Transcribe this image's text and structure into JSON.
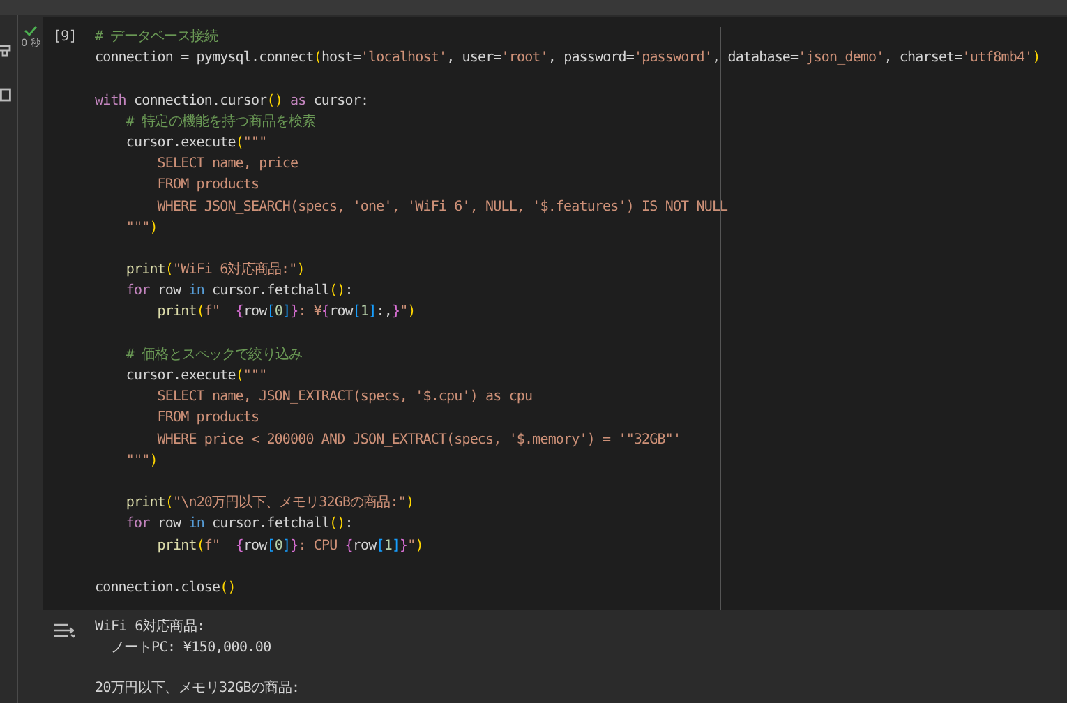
{
  "cell": {
    "execution_count": "[9]",
    "run_time": "0 秒",
    "run_ok": true,
    "code_lines": [
      {
        "kind": "code",
        "tokens": [
          {
            "kind": "comment",
            "text": "# データベース接続"
          }
        ]
      },
      {
        "kind": "code",
        "tokens": [
          {
            "kind": "plain",
            "text": "connection = pymysql.connect"
          },
          {
            "kind": "paren",
            "text": "("
          },
          {
            "kind": "plain",
            "text": "host="
          },
          {
            "kind": "string",
            "text": "'localhost'"
          },
          {
            "kind": "plain",
            "text": ", user="
          },
          {
            "kind": "string",
            "text": "'root'"
          },
          {
            "kind": "plain",
            "text": ", password="
          },
          {
            "kind": "string",
            "text": "'password'"
          },
          {
            "kind": "plain",
            "text": ", database="
          },
          {
            "kind": "string",
            "text": "'json_demo'"
          },
          {
            "kind": "plain",
            "text": ", charset="
          },
          {
            "kind": "string",
            "text": "'utf8mb4'"
          },
          {
            "kind": "paren",
            "text": ")"
          }
        ]
      },
      {
        "kind": "blank"
      },
      {
        "kind": "code",
        "tokens": [
          {
            "kind": "keyword",
            "text": "with"
          },
          {
            "kind": "plain",
            "text": " connection.cursor"
          },
          {
            "kind": "paren",
            "text": "()"
          },
          {
            "kind": "keyword",
            "text": " as"
          },
          {
            "kind": "plain",
            "text": " cursor:"
          }
        ]
      },
      {
        "kind": "code",
        "tokens": [
          {
            "kind": "comment",
            "text": "    # 特定の機能を持つ商品を検索"
          }
        ]
      },
      {
        "kind": "code",
        "tokens": [
          {
            "kind": "plain",
            "text": "    cursor.execute"
          },
          {
            "kind": "paren",
            "text": "("
          },
          {
            "kind": "string",
            "text": "\"\"\""
          }
        ]
      },
      {
        "kind": "code",
        "tokens": [
          {
            "kind": "string",
            "text": "        SELECT name, price"
          }
        ]
      },
      {
        "kind": "code",
        "tokens": [
          {
            "kind": "string",
            "text": "        FROM products"
          }
        ]
      },
      {
        "kind": "code",
        "tokens": [
          {
            "kind": "string",
            "text": "        WHERE JSON_SEARCH(specs, 'one', 'WiFi 6', NULL, '$.features') IS NOT NULL"
          }
        ]
      },
      {
        "kind": "code",
        "tokens": [
          {
            "kind": "string",
            "text": "    \"\"\""
          },
          {
            "kind": "paren",
            "text": ")"
          }
        ]
      },
      {
        "kind": "blank"
      },
      {
        "kind": "code",
        "tokens": [
          {
            "kind": "func",
            "text": "    print"
          },
          {
            "kind": "paren",
            "text": "("
          },
          {
            "kind": "string",
            "text": "\"WiFi 6対応商品:\""
          },
          {
            "kind": "paren",
            "text": ")"
          }
        ]
      },
      {
        "kind": "code",
        "tokens": [
          {
            "kind": "keyword",
            "text": "    for"
          },
          {
            "kind": "plain",
            "text": " row "
          },
          {
            "kind": "operator",
            "text": "in"
          },
          {
            "kind": "plain",
            "text": " cursor.fetchall"
          },
          {
            "kind": "paren",
            "text": "()"
          },
          {
            "kind": "plain",
            "text": ":"
          }
        ]
      },
      {
        "kind": "code",
        "tokens": [
          {
            "kind": "func",
            "text": "        print"
          },
          {
            "kind": "paren",
            "text": "("
          },
          {
            "kind": "string",
            "text": "f\"  "
          },
          {
            "kind": "brace",
            "text": "{"
          },
          {
            "kind": "plain",
            "text": "row"
          },
          {
            "kind": "bracket",
            "text": "["
          },
          {
            "kind": "number",
            "text": "0"
          },
          {
            "kind": "bracket",
            "text": "]"
          },
          {
            "kind": "brace",
            "text": "}"
          },
          {
            "kind": "string",
            "text": ": ¥"
          },
          {
            "kind": "brace",
            "text": "{"
          },
          {
            "kind": "plain",
            "text": "row"
          },
          {
            "kind": "bracket",
            "text": "["
          },
          {
            "kind": "number",
            "text": "1"
          },
          {
            "kind": "bracket",
            "text": "]"
          },
          {
            "kind": "plain",
            "text": ":,"
          },
          {
            "kind": "brace",
            "text": "}"
          },
          {
            "kind": "string",
            "text": "\""
          },
          {
            "kind": "paren",
            "text": ")"
          }
        ]
      },
      {
        "kind": "blank"
      },
      {
        "kind": "code",
        "tokens": [
          {
            "kind": "comment",
            "text": "    # 価格とスペックで絞り込み"
          }
        ]
      },
      {
        "kind": "code",
        "tokens": [
          {
            "kind": "plain",
            "text": "    cursor.execute"
          },
          {
            "kind": "paren",
            "text": "("
          },
          {
            "kind": "string",
            "text": "\"\"\""
          }
        ]
      },
      {
        "kind": "code",
        "tokens": [
          {
            "kind": "string",
            "text": "        SELECT name, JSON_EXTRACT(specs, '$.cpu') as cpu"
          }
        ]
      },
      {
        "kind": "code",
        "tokens": [
          {
            "kind": "string",
            "text": "        FROM products"
          }
        ]
      },
      {
        "kind": "code",
        "tokens": [
          {
            "kind": "string",
            "text": "        WHERE price < 200000 AND JSON_EXTRACT(specs, '$.memory') = '\"32GB\"'"
          }
        ]
      },
      {
        "kind": "code",
        "tokens": [
          {
            "kind": "string",
            "text": "    \"\"\""
          },
          {
            "kind": "paren",
            "text": ")"
          }
        ]
      },
      {
        "kind": "blank"
      },
      {
        "kind": "code",
        "tokens": [
          {
            "kind": "func",
            "text": "    print"
          },
          {
            "kind": "paren",
            "text": "("
          },
          {
            "kind": "string",
            "text": "\"\\n20万円以下、メモリ32GBの商品:\""
          },
          {
            "kind": "paren",
            "text": ")"
          }
        ]
      },
      {
        "kind": "code",
        "tokens": [
          {
            "kind": "keyword",
            "text": "    for"
          },
          {
            "kind": "plain",
            "text": " row "
          },
          {
            "kind": "operator",
            "text": "in"
          },
          {
            "kind": "plain",
            "text": " cursor.fetchall"
          },
          {
            "kind": "paren",
            "text": "()"
          },
          {
            "kind": "plain",
            "text": ":"
          }
        ]
      },
      {
        "kind": "code",
        "tokens": [
          {
            "kind": "func",
            "text": "        print"
          },
          {
            "kind": "paren",
            "text": "("
          },
          {
            "kind": "string",
            "text": "f\"  "
          },
          {
            "kind": "brace",
            "text": "{"
          },
          {
            "kind": "plain",
            "text": "row"
          },
          {
            "kind": "bracket",
            "text": "["
          },
          {
            "kind": "number",
            "text": "0"
          },
          {
            "kind": "bracket",
            "text": "]"
          },
          {
            "kind": "brace",
            "text": "}"
          },
          {
            "kind": "string",
            "text": ": CPU "
          },
          {
            "kind": "brace",
            "text": "{"
          },
          {
            "kind": "plain",
            "text": "row"
          },
          {
            "kind": "bracket",
            "text": "["
          },
          {
            "kind": "number",
            "text": "1"
          },
          {
            "kind": "bracket",
            "text": "]"
          },
          {
            "kind": "brace",
            "text": "}"
          },
          {
            "kind": "string",
            "text": "\""
          },
          {
            "kind": "paren",
            "text": ")"
          }
        ]
      },
      {
        "kind": "blank"
      },
      {
        "kind": "code",
        "tokens": [
          {
            "kind": "plain",
            "text": "connection.close"
          },
          {
            "kind": "paren",
            "text": "()"
          }
        ]
      }
    ],
    "output_lines": [
      {
        "kind": "text",
        "text": "WiFi 6対応商品:"
      },
      {
        "kind": "text",
        "text": "  ノートPC: ¥150,000.00"
      },
      {
        "kind": "blank"
      },
      {
        "kind": "text",
        "text": "20万円以下、メモリ32GBの商品:"
      }
    ]
  }
}
